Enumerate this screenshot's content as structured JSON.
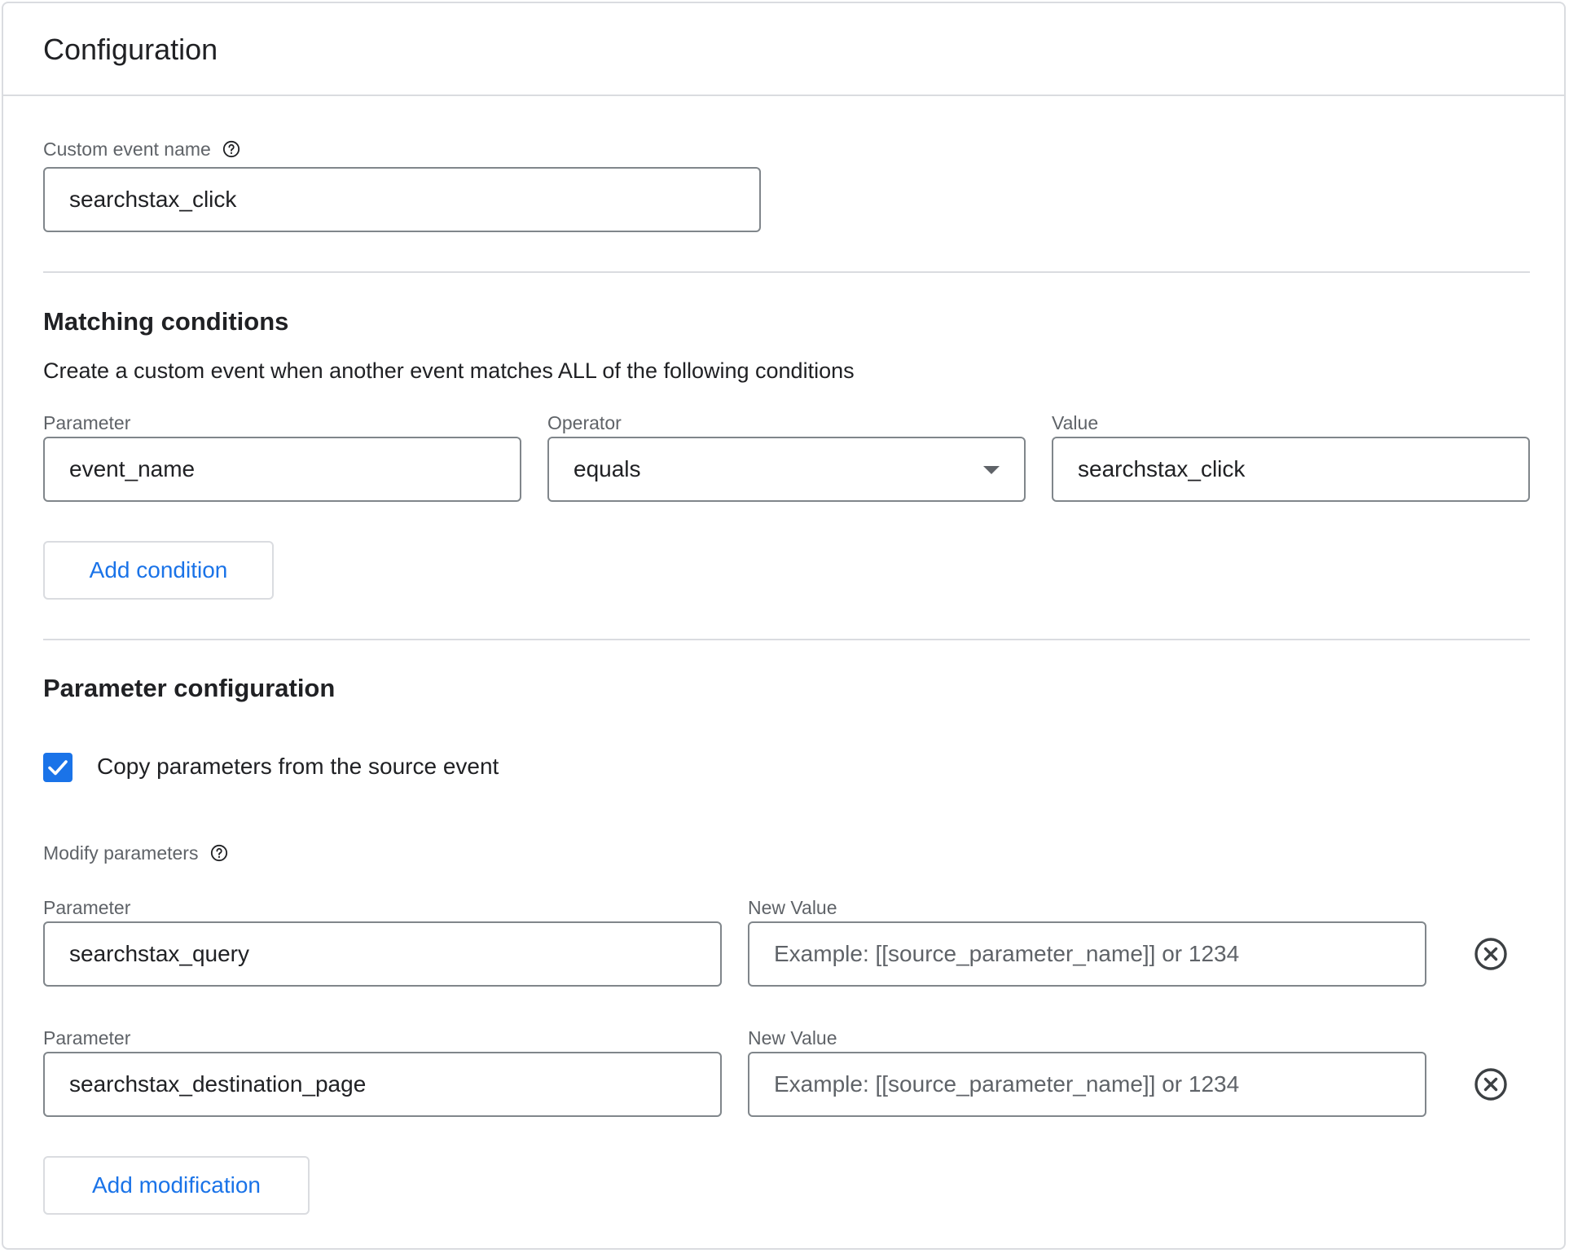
{
  "card": {
    "title": "Configuration"
  },
  "custom_event": {
    "label": "Custom event name",
    "value": "searchstax_click",
    "help_icon": "help-circle-icon"
  },
  "matching": {
    "heading": "Matching conditions",
    "description": "Create a custom event when another event matches ALL of the following conditions",
    "parameter_label": "Parameter",
    "operator_label": "Operator",
    "value_label": "Value",
    "conditions": [
      {
        "parameter": "event_name",
        "operator": "equals",
        "value": "searchstax_click"
      }
    ],
    "add_condition_label": "Add condition"
  },
  "param_config": {
    "heading": "Parameter configuration",
    "copy_checkbox_label": "Copy parameters from the source event",
    "copy_checked": true,
    "modify_label": "Modify parameters",
    "modify_help_icon": "help-circle-icon",
    "modifications": [
      {
        "parameter_label": "Parameter",
        "parameter": "searchstax_query",
        "new_value_label": "New Value",
        "new_value": "",
        "new_value_placeholder": "Example: [[source_parameter_name]] or 1234",
        "remove_icon": "cancel-circle-icon"
      },
      {
        "parameter_label": "Parameter",
        "parameter": "searchstax_destination_page",
        "new_value_label": "New Value",
        "new_value": "",
        "new_value_placeholder": "Example: [[source_parameter_name]] or 1234",
        "remove_icon": "cancel-circle-icon"
      }
    ],
    "add_modification_label": "Add modification"
  },
  "colors": {
    "accent": "#1a73e8",
    "border": "#dadce0",
    "input_border": "#80868b",
    "text_primary": "#202124",
    "text_secondary": "#5f6368"
  }
}
